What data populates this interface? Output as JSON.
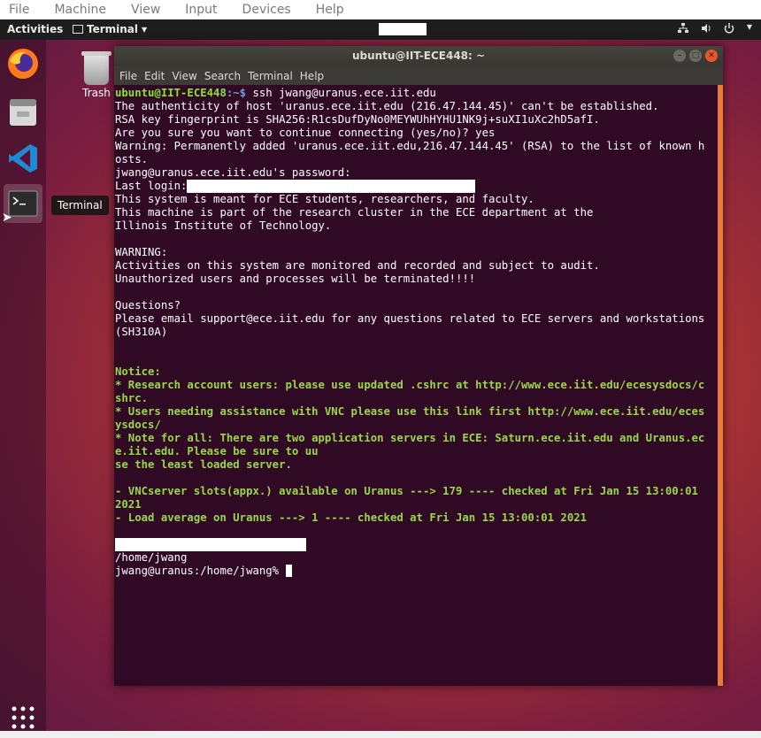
{
  "host_menu": [
    "File",
    "Machine",
    "View",
    "Input",
    "Devices",
    "Help"
  ],
  "top_panel": {
    "activities": "Activities",
    "app_menu": "Terminal",
    "tray_icons": [
      "network-icon",
      "volume-icon",
      "power-icon"
    ]
  },
  "dock": {
    "apps": [
      "firefox-icon",
      "files-icon",
      "vscode-icon",
      "terminal-icon",
      "show-apps-icon"
    ],
    "tooltip": "Terminal"
  },
  "desktop": {
    "trash_label": "Trash"
  },
  "terminal": {
    "title": "ubuntu@IIT-ECE448: ~",
    "menu": [
      "File",
      "Edit",
      "View",
      "Search",
      "Terminal",
      "Help"
    ],
    "prompt_user": "ubuntu@IIT-ECE448",
    "prompt_path": ":~$ ",
    "command": "ssh jwang@uranus.ece.iit.edu",
    "lines_plain_1": [
      "The authenticity of host 'uranus.ece.iit.edu (216.47.144.45)' can't be established.",
      "RSA key fingerprint is SHA256:R1csDufDyNo0MEYWUhHYHU1NK9j+suXI1uXc2hD5afI.",
      "Are you sure you want to continue connecting (yes/no)? yes",
      "Warning: Permanently added 'uranus.ece.iit.edu,216.47.144.45' (RSA) to the list of known h",
      "osts.",
      "jwang@uranus.ece.iit.edu's password:"
    ],
    "last_login_label": "Last login:",
    "lines_plain_2": [
      "This system is meant for ECE students, researchers, and faculty.",
      "This machine is part of the research cluster in the ECE department at the",
      "Illinois Institute of Technology.",
      "",
      "WARNING:",
      "Activities on this system are monitored and recorded and subject to audit.",
      "Unauthorized users and processes will be terminated!!!!",
      "",
      "Questions?",
      "Please email support@ece.iit.edu for any questions related to ECE servers and workstations",
      "(SH310A)",
      "",
      ""
    ],
    "lines_notice": [
      "Notice:",
      "* Research account users: please use updated .cshrc at http://www.ece.iit.edu/ecesysdocs/c",
      "shrc.",
      "* Users needing assistance with VNC please use this link first http://www.ece.iit.edu/eces",
      "ysdocs/",
      "* Note for all: There are two application servers in ECE: Saturn.ece.iit.edu and Uranus.ec",
      "e.iit.edu. Please be sure to uu",
      "se the least loaded server.",
      "",
      "- VNCserver slots(appx.) available on Uranus ---> 179 ---- checked at Fri Jan 15 13:00:01",
      "2021",
      "- Load average on Uranus ---> 1 ---- checked at Fri Jan 15 13:00:01 2021",
      ""
    ],
    "home_dir": "/home/jwang",
    "final_prompt": "jwang@uranus:/home/jwang% "
  }
}
